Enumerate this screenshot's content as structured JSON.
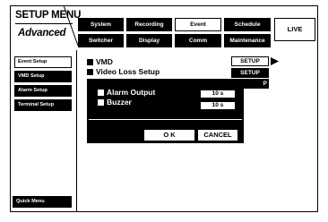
{
  "title": {
    "line1": "SETUP MENU",
    "line2": "Advanced"
  },
  "tabs_top": [
    {
      "label": "System",
      "active": false
    },
    {
      "label": "Recording",
      "active": false
    },
    {
      "label": "Event",
      "active": true
    },
    {
      "label": "Schedule",
      "active": false
    }
  ],
  "tabs_bottom": [
    {
      "label": "Switcher",
      "active": false
    },
    {
      "label": "Display",
      "active": false
    },
    {
      "label": "Comm",
      "active": false
    },
    {
      "label": "Maintenance",
      "active": false
    }
  ],
  "live_label": "LIVE",
  "sidebar": {
    "items": [
      {
        "label": "Event Setup",
        "active": true
      },
      {
        "label": "VMD Setup",
        "active": false
      },
      {
        "label": "Alarm Setup",
        "active": false
      },
      {
        "label": "Terminal Setup",
        "active": false
      }
    ],
    "quick_menu": "Quick Menu"
  },
  "main": {
    "headings": [
      "VMD",
      "Video Loss Setup"
    ],
    "setup_button_1": "SETUP",
    "setup_button_2": "SETUP",
    "partial_button_text": "P"
  },
  "dialog": {
    "rows": [
      {
        "label": "Alarm Output",
        "value": "10 s"
      },
      {
        "label": "Buzzer",
        "value": "10 s"
      }
    ],
    "ok_label": "O K",
    "cancel_label": "CANCEL"
  },
  "colors": {
    "background": "#ffffff",
    "foreground": "#000000"
  },
  "icons": {
    "setup_arrow": "triangle-right-icon"
  }
}
